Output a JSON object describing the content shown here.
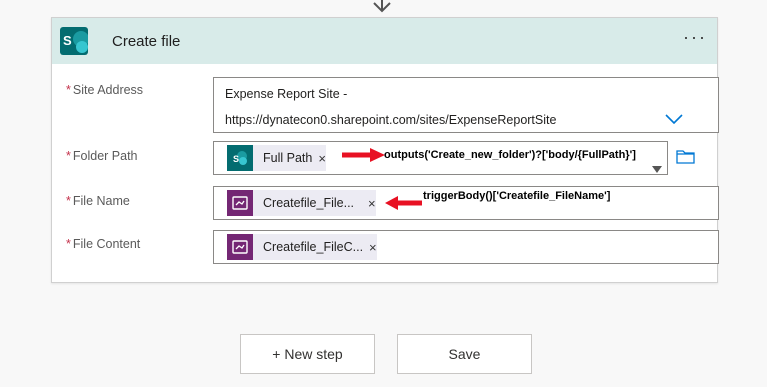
{
  "card": {
    "title": "Create file",
    "more_label": "···"
  },
  "fields": {
    "site_address": {
      "label": "Site Address",
      "line1": "Expense Report Site -",
      "line2": "https://dynatecon0.sharepoint.com/sites/ExpenseReportSite"
    },
    "folder_path": {
      "label": "Folder Path",
      "token": "Full Path",
      "annotation": "outputs('Create_new_folder')?['body/{FullPath}']"
    },
    "file_name": {
      "label": "File Name",
      "token": "Createfile_File...",
      "annotation": "triggerBody()['Createfile_FileName']"
    },
    "file_content": {
      "label": "File Content",
      "token": "Createfile_FileC..."
    }
  },
  "required_mark": "*",
  "close_glyph": "×",
  "buttons": {
    "new_step": "+ New step",
    "save": "Save"
  },
  "colors": {
    "header_bg": "#d8ebe9",
    "sharepoint": "#036c70",
    "power_apps": "#742774",
    "accent_blue": "#0078d4",
    "annotation_arrow": "#e81123",
    "required": "#c4314b"
  },
  "icons": {
    "flow_arrow": "arrow-down-icon",
    "connector": "sharepoint-icon",
    "dropdown": "chevron-down-icon",
    "folder": "folder-icon",
    "dynamic_content": "power-apps-icon"
  }
}
